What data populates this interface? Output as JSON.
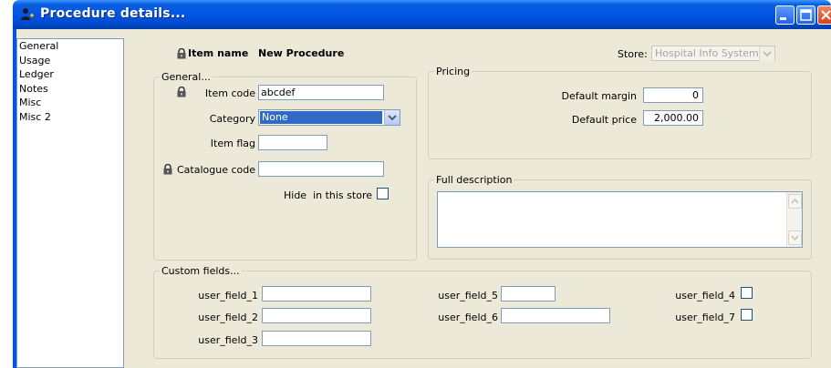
{
  "window": {
    "title": "Procedure details...",
    "icon": "person-plus-icon"
  },
  "nav": {
    "items": [
      "General",
      "Usage",
      "Ledger",
      "Notes",
      "Misc",
      "Misc 2"
    ]
  },
  "header": {
    "item_name_label": "Item name",
    "item_name_value": "New Procedure",
    "store_label": "Store:",
    "store_value": "Hospital Info System"
  },
  "general": {
    "title": "General...",
    "item_code_label": "Item code",
    "item_code_value": "abcdef",
    "category_label": "Category",
    "category_value": "None",
    "item_flag_label": "Item flag",
    "item_flag_value": "",
    "catalogue_code_label": "Catalogue code",
    "catalogue_code_value": "",
    "hide_label": "Hide  in this store",
    "hide_checked": false
  },
  "pricing": {
    "title": "Pricing",
    "default_margin_label": "Default margin",
    "default_margin_value": "0",
    "default_price_label": "Default price",
    "default_price_value": "2,000.00"
  },
  "description": {
    "title": "Full description",
    "value": ""
  },
  "custom": {
    "title": "Custom fields...",
    "f1_label": "user_field_1",
    "f2_label": "user_field_2",
    "f3_label": "user_field_3",
    "f4_label": "user_field_4",
    "f5_label": "user_field_5",
    "f6_label": "user_field_6",
    "f7_label": "user_field_7"
  },
  "colors": {
    "titlebar": "#0054e3",
    "selection": "#316ac5",
    "dialog_bg": "#ece9d8"
  }
}
